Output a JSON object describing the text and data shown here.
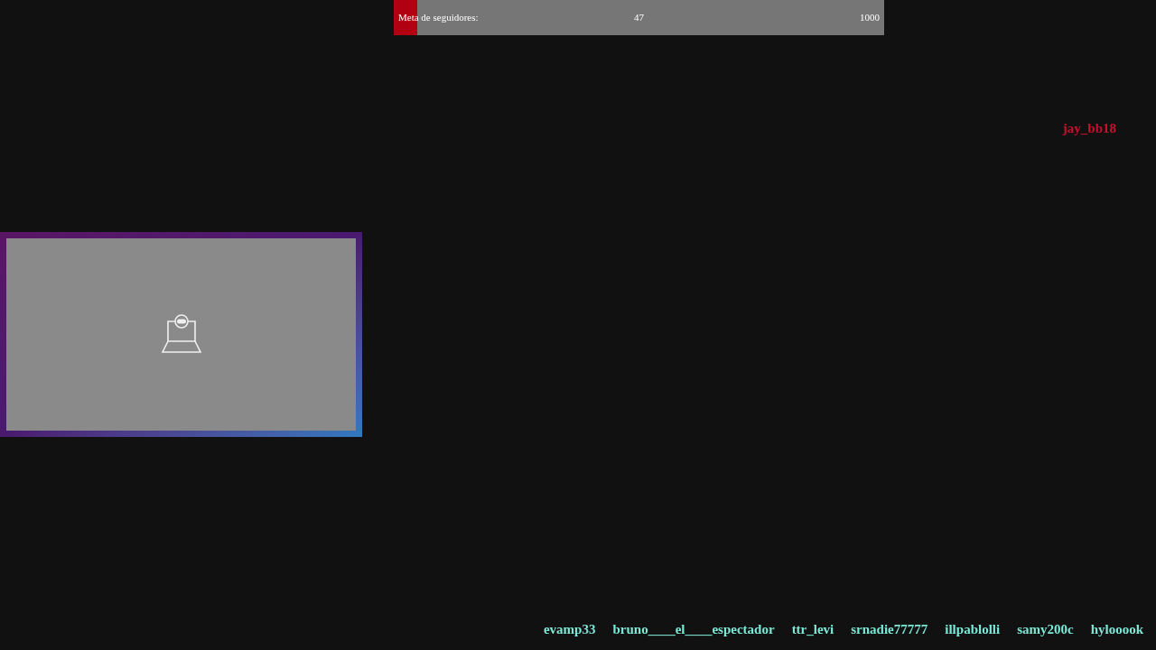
{
  "follower_goal": {
    "label": "Meta de seguidores:",
    "current": "47",
    "target": "1000",
    "level": 0.047
  },
  "latest_follower": "jay_bb18",
  "camera": {
    "kind": "camera-placeholder"
  },
  "recent_followers": [
    "evamp33",
    "bruno____el____espectador",
    "ttr_levi",
    "srnadie77777",
    "illpablolli",
    "samy200c",
    "hylooook"
  ]
}
